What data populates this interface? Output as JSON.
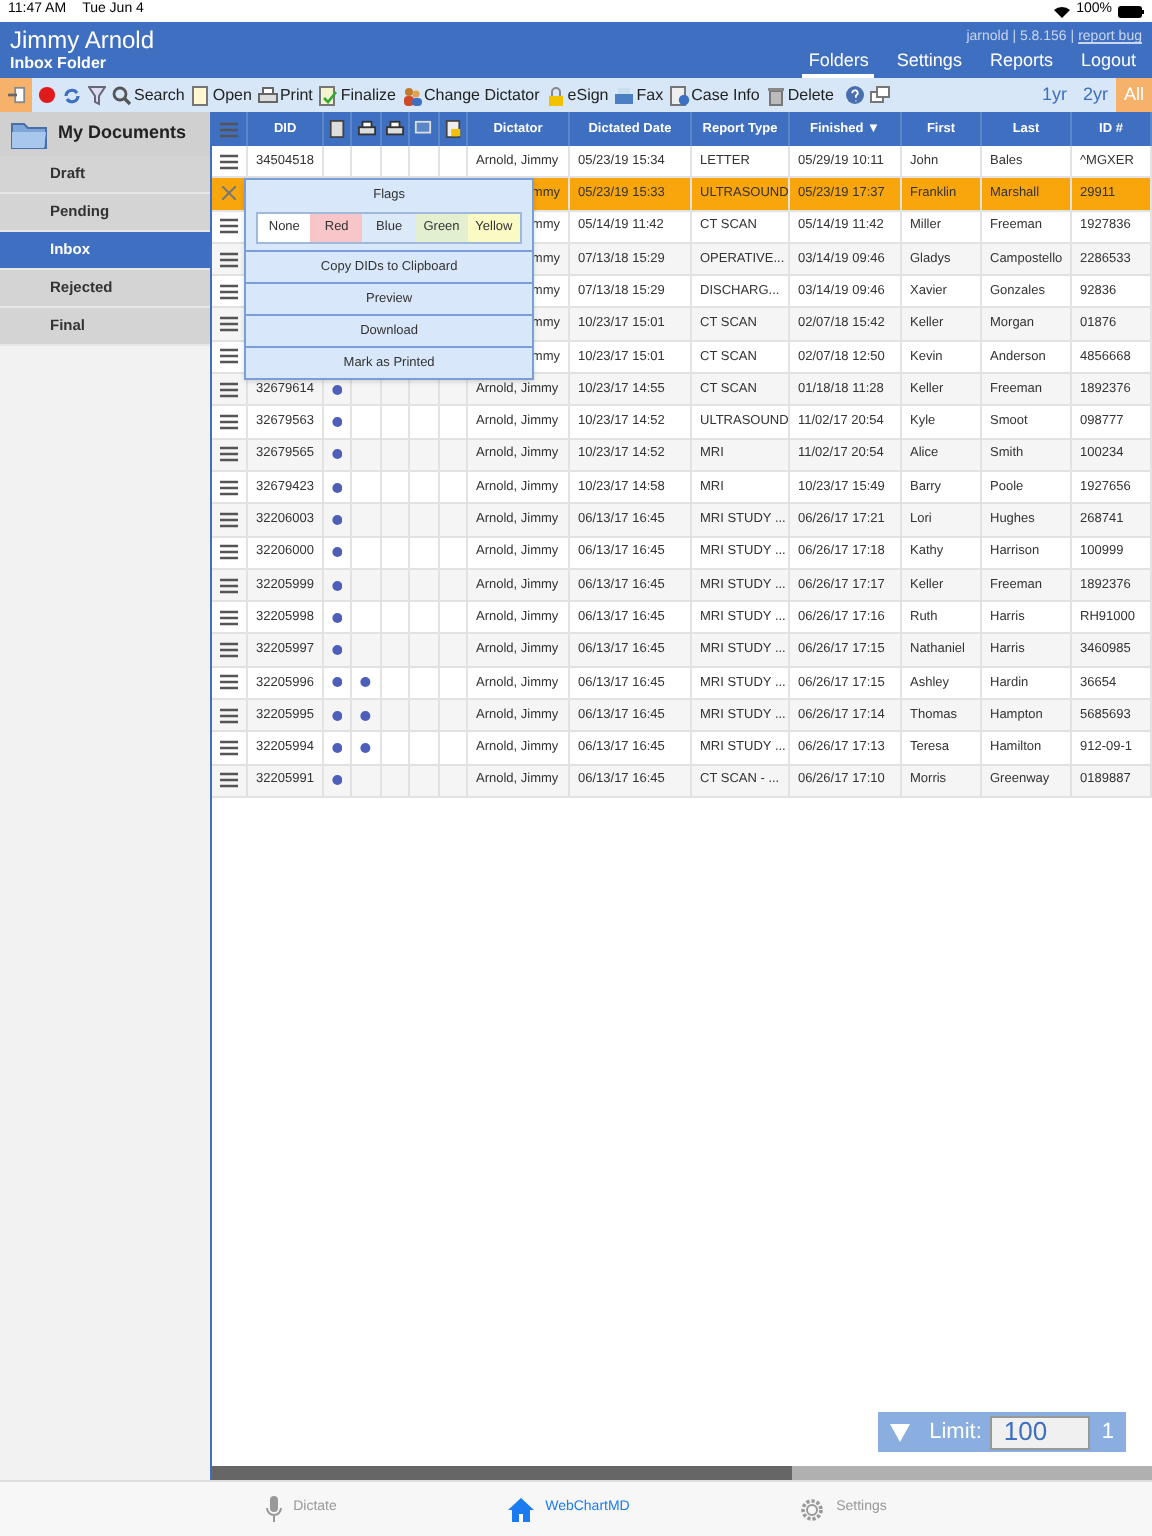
{
  "status_bar": {
    "time": "11:47 AM",
    "date": "Tue Jun 4",
    "battery": "100%"
  },
  "header": {
    "title": "Jimmy Arnold",
    "subtitle": "Inbox Folder",
    "user_info": "jarnold | 5.8.156 |",
    "report_link": "report bug",
    "nav": [
      {
        "label": "Folders",
        "selected": true
      },
      {
        "label": "Settings",
        "selected": false
      },
      {
        "label": "Reports",
        "selected": false
      },
      {
        "label": "Logout",
        "selected": false
      }
    ]
  },
  "toolbar": {
    "actions": [
      {
        "label": "Search",
        "kind": "search"
      },
      {
        "label": "Open",
        "kind": "open"
      },
      {
        "label": "Print",
        "kind": "print"
      },
      {
        "label": "Finalize",
        "kind": "finalize"
      },
      {
        "label": "Change Dictator",
        "kind": "dictator"
      },
      {
        "label": "eSign",
        "kind": "esign"
      },
      {
        "label": "Fax",
        "kind": "fax"
      },
      {
        "label": "Case Info",
        "kind": "caseinfo"
      },
      {
        "label": "Delete",
        "kind": "delete"
      }
    ],
    "ranges": [
      {
        "label": "1yr",
        "selected": false
      },
      {
        "label": "2yr",
        "selected": false
      },
      {
        "label": "All",
        "selected": true
      }
    ]
  },
  "sidebar": {
    "title": "My Documents",
    "items": [
      {
        "label": "Draft",
        "selected": false
      },
      {
        "label": "Pending",
        "selected": false
      },
      {
        "label": "Inbox",
        "selected": true
      },
      {
        "label": "Rejected",
        "selected": false
      },
      {
        "label": "Final",
        "selected": false
      }
    ]
  },
  "table": {
    "columns": [
      "DID",
      "Dictator",
      "Dictated Date",
      "Report Type",
      "Finished ▼",
      "First",
      "Last",
      "ID #"
    ],
    "rows": [
      {
        "selected": false,
        "did": "34504518",
        "flag_a": false,
        "flag_b": false,
        "dictator": "Arnold, Jimmy",
        "dictated": "05/23/19 15:34",
        "type": "LETTER",
        "finished": "05/29/19 10:11",
        "first": "John",
        "last": "Bales",
        "id": "^MGXER"
      },
      {
        "selected": true,
        "covered": true,
        "dictator": "mmy",
        "dictated": "05/23/19 15:33",
        "type": "ULTRASOUND",
        "finished": "05/23/19 17:37",
        "first": "Franklin",
        "last": "Marshall",
        "id": "29911"
      },
      {
        "selected": false,
        "covered": true,
        "dictator": "mmy",
        "dictated": "05/14/19 11:42",
        "type": "CT SCAN",
        "finished": "05/14/19 11:42",
        "first": "Miller",
        "last": "Freeman",
        "id": "1927836"
      },
      {
        "selected": false,
        "covered": true,
        "dictator": "mmy",
        "dictated": "07/13/18 15:29",
        "type": "OPERATIVE...",
        "finished": "03/14/19 09:46",
        "first": "Gladys",
        "last": "Campostello",
        "id": "2286533"
      },
      {
        "selected": false,
        "covered": true,
        "dictator": "mmy",
        "dictated": "07/13/18 15:29",
        "type": "DISCHARG...",
        "finished": "03/14/19 09:46",
        "first": "Xavier",
        "last": "Gonzales",
        "id": "92836"
      },
      {
        "selected": false,
        "covered": true,
        "dictator": "mmy",
        "dictated": "10/23/17 15:01",
        "type": "CT SCAN",
        "finished": "02/07/18 15:42",
        "first": "Keller",
        "last": "Morgan",
        "id": "01876"
      },
      {
        "selected": false,
        "covered": true,
        "dictator": "mmy",
        "dictated": "10/23/17 15:01",
        "type": "CT SCAN",
        "finished": "02/07/18 12:50",
        "first": "Kevin",
        "last": "Anderson",
        "id": "4856668"
      },
      {
        "selected": false,
        "did": "32679614",
        "flag_a": true,
        "flag_b": false,
        "dictator": "Arnold, Jimmy",
        "dictated": "10/23/17 14:55",
        "type": "CT SCAN",
        "finished": "01/18/18 11:28",
        "first": "Keller",
        "last": "Freeman",
        "id": "1892376"
      },
      {
        "selected": false,
        "did": "32679563",
        "flag_a": true,
        "flag_b": false,
        "dictator": "Arnold, Jimmy",
        "dictated": "10/23/17 14:52",
        "type": "ULTRASOUND",
        "finished": "11/02/17 20:54",
        "first": "Kyle",
        "last": "Smoot",
        "id": "098777"
      },
      {
        "selected": false,
        "did": "32679565",
        "flag_a": true,
        "flag_b": false,
        "dictator": "Arnold, Jimmy",
        "dictated": "10/23/17 14:52",
        "type": "MRI",
        "finished": "11/02/17 20:54",
        "first": "Alice",
        "last": "Smith",
        "id": "100234"
      },
      {
        "selected": false,
        "did": "32679423",
        "flag_a": true,
        "flag_b": false,
        "dictator": "Arnold, Jimmy",
        "dictated": "10/23/17 14:58",
        "type": "MRI",
        "finished": "10/23/17 15:49",
        "first": "Barry",
        "last": "Poole",
        "id": "1927656"
      },
      {
        "selected": false,
        "did": "32206003",
        "flag_a": true,
        "flag_b": false,
        "dictator": "Arnold, Jimmy",
        "dictated": "06/13/17 16:45",
        "type": "MRI STUDY ...",
        "finished": "06/26/17 17:21",
        "first": "Lori",
        "last": "Hughes",
        "id": "268741"
      },
      {
        "selected": false,
        "did": "32206000",
        "flag_a": true,
        "flag_b": false,
        "dictator": "Arnold, Jimmy",
        "dictated": "06/13/17 16:45",
        "type": "MRI STUDY ...",
        "finished": "06/26/17 17:18",
        "first": "Kathy",
        "last": "Harrison",
        "id": "100999"
      },
      {
        "selected": false,
        "did": "32205999",
        "flag_a": true,
        "flag_b": false,
        "dictator": "Arnold, Jimmy",
        "dictated": "06/13/17 16:45",
        "type": "MRI STUDY ...",
        "finished": "06/26/17 17:17",
        "first": "Keller",
        "last": "Freeman",
        "id": "1892376"
      },
      {
        "selected": false,
        "did": "32205998",
        "flag_a": true,
        "flag_b": false,
        "dictator": "Arnold, Jimmy",
        "dictated": "06/13/17 16:45",
        "type": "MRI STUDY ...",
        "finished": "06/26/17 17:16",
        "first": "Ruth",
        "last": "Harris",
        "id": "RH91000"
      },
      {
        "selected": false,
        "did": "32205997",
        "flag_a": true,
        "flag_b": false,
        "dictator": "Arnold, Jimmy",
        "dictated": "06/13/17 16:45",
        "type": "MRI STUDY ...",
        "finished": "06/26/17 17:15",
        "first": "Nathaniel",
        "last": "Harris",
        "id": "3460985"
      },
      {
        "selected": false,
        "did": "32205996",
        "flag_a": true,
        "flag_b": true,
        "dictator": "Arnold, Jimmy",
        "dictated": "06/13/17 16:45",
        "type": "MRI STUDY ...",
        "finished": "06/26/17 17:15",
        "first": "Ashley",
        "last": "Hardin",
        "id": "36654"
      },
      {
        "selected": false,
        "did": "32205995",
        "flag_a": true,
        "flag_b": true,
        "dictator": "Arnold, Jimmy",
        "dictated": "06/13/17 16:45",
        "type": "MRI STUDY ...",
        "finished": "06/26/17 17:14",
        "first": "Thomas",
        "last": "Hampton",
        "id": "5685693"
      },
      {
        "selected": false,
        "did": "32205994",
        "flag_a": true,
        "flag_b": true,
        "dictator": "Arnold, Jimmy",
        "dictated": "06/13/17 16:45",
        "type": "MRI STUDY ...",
        "finished": "06/26/17 17:13",
        "first": "Teresa",
        "last": "Hamilton",
        "id": "912-09-1"
      },
      {
        "selected": false,
        "did": "32205991",
        "flag_a": true,
        "flag_b": false,
        "dictator": "Arnold, Jimmy",
        "dictated": "06/13/17 16:45",
        "type": "CT SCAN - ...",
        "finished": "06/26/17 17:10",
        "first": "Morris",
        "last": "Greenway",
        "id": "0189887"
      }
    ]
  },
  "popup": {
    "title": "Flags",
    "flags": [
      {
        "label": "None",
        "color": "#ffffff"
      },
      {
        "label": "Red",
        "color": "#f8c5c8"
      },
      {
        "label": "Blue",
        "color": "#dbe9f8"
      },
      {
        "label": "Green",
        "color": "#e3f0cf"
      },
      {
        "label": "Yellow",
        "color": "#fafac4"
      }
    ],
    "actions": [
      "Copy DIDs to Clipboard",
      "Preview",
      "Download",
      "Mark as Printed"
    ]
  },
  "pager": {
    "label": "Limit:",
    "value": "100",
    "page": "1"
  },
  "tab_bar": [
    {
      "label": "Dictate",
      "kind": "mic",
      "selected": false
    },
    {
      "label": "WebChartMD",
      "kind": "home",
      "selected": true
    },
    {
      "label": "Settings",
      "kind": "gear",
      "selected": false
    }
  ]
}
